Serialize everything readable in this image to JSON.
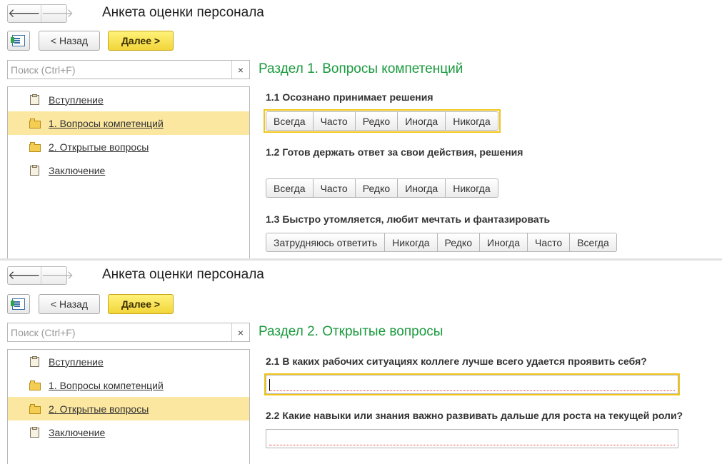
{
  "window_title": "Анкета оценки персонала",
  "toolbar": {
    "back_label": "< Назад",
    "next_label": "Далее >"
  },
  "search": {
    "placeholder": "Поиск (Ctrl+F)",
    "clear": "×"
  },
  "nav": {
    "back_arrow": "🡐",
    "forward_arrow": "🡒"
  },
  "tree_items": [
    {
      "label": "Вступление",
      "icon": "page-icon"
    },
    {
      "label": "1. Вопросы компетенций",
      "icon": "folder-icon"
    },
    {
      "label": "2. Открытые вопросы",
      "icon": "folder-icon"
    },
    {
      "label": "Заключение",
      "icon": "page-icon"
    }
  ],
  "screen1": {
    "selected_item": "1. Вопросы компетенций",
    "section_title": "Раздел 1. Вопросы компетенций",
    "questions": [
      {
        "text": "1.1 Осознано принимает решения",
        "options": [
          "Всегда",
          "Часто",
          "Редко",
          "Иногда",
          "Никогда"
        ]
      },
      {
        "text": "1.2 Готов держать ответ за свои действия, решения",
        "options": [
          "Всегда",
          "Часто",
          "Редко",
          "Иногда",
          "Никогда"
        ]
      },
      {
        "text": "1.3 Быстро утомляется, любит мечтать и фантазировать",
        "options": [
          "Затрудняюсь ответить",
          "Никогда",
          "Редко",
          "Иногда",
          "Часто",
          "Всегда"
        ]
      }
    ]
  },
  "screen2": {
    "selected_item": "2. Открытые вопросы",
    "section_title": "Раздел 2. Открытые вопросы",
    "questions": [
      {
        "text": "2.1 В каких рабочих ситуациях коллеге лучше всего удается проявить себя?",
        "value": ""
      },
      {
        "text": "2.2 Какие навыки или знания важно развивать дальше для роста на текущей роли?",
        "value": ""
      }
    ]
  },
  "colors": {
    "accent_green": "#1a9a3e",
    "selection_yellow": "#fbe7a0",
    "primary_button": "#f2d53a"
  }
}
